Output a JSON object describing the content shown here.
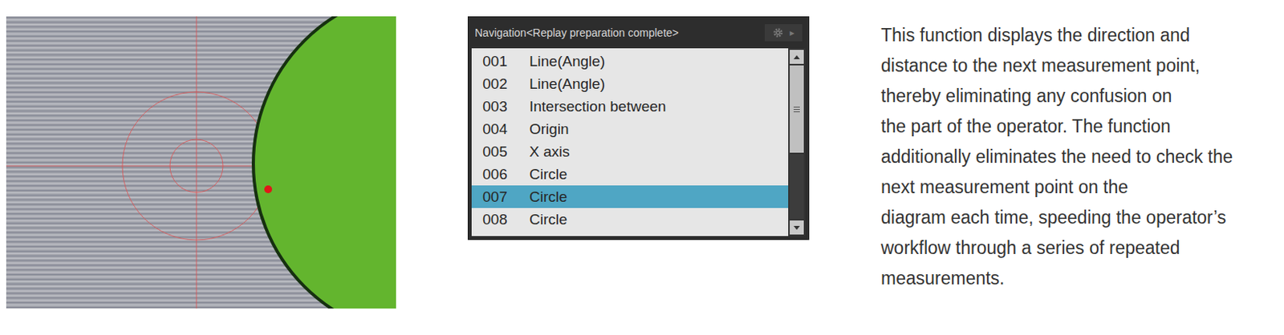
{
  "navigation": {
    "title": "Navigation<Replay preparation complete>",
    "header_button": {
      "arrow": "▸"
    },
    "items": [
      {
        "number": "001",
        "label": "Line(Angle)",
        "selected": false
      },
      {
        "number": "002",
        "label": "Line(Angle)",
        "selected": false
      },
      {
        "number": "003",
        "label": "Intersection between",
        "selected": false
      },
      {
        "number": "004",
        "label": "Origin",
        "selected": false
      },
      {
        "number": "005",
        "label": "X axis",
        "selected": false
      },
      {
        "number": "006",
        "label": "Circle",
        "selected": false
      },
      {
        "number": "007",
        "label": "Circle",
        "selected": true
      },
      {
        "number": "008",
        "label": "Circle",
        "selected": false
      }
    ]
  },
  "description": {
    "lines": [
      "This function displays the direction and",
      "distance to the next measurement point,",
      "thereby eliminating any confusion on",
      "the part of the operator. The function",
      "additionally eliminates the need to check the",
      "next measurement point on the",
      "diagram each time, speeding the operator’s",
      "workflow through a series of repeated",
      "measurements."
    ]
  }
}
